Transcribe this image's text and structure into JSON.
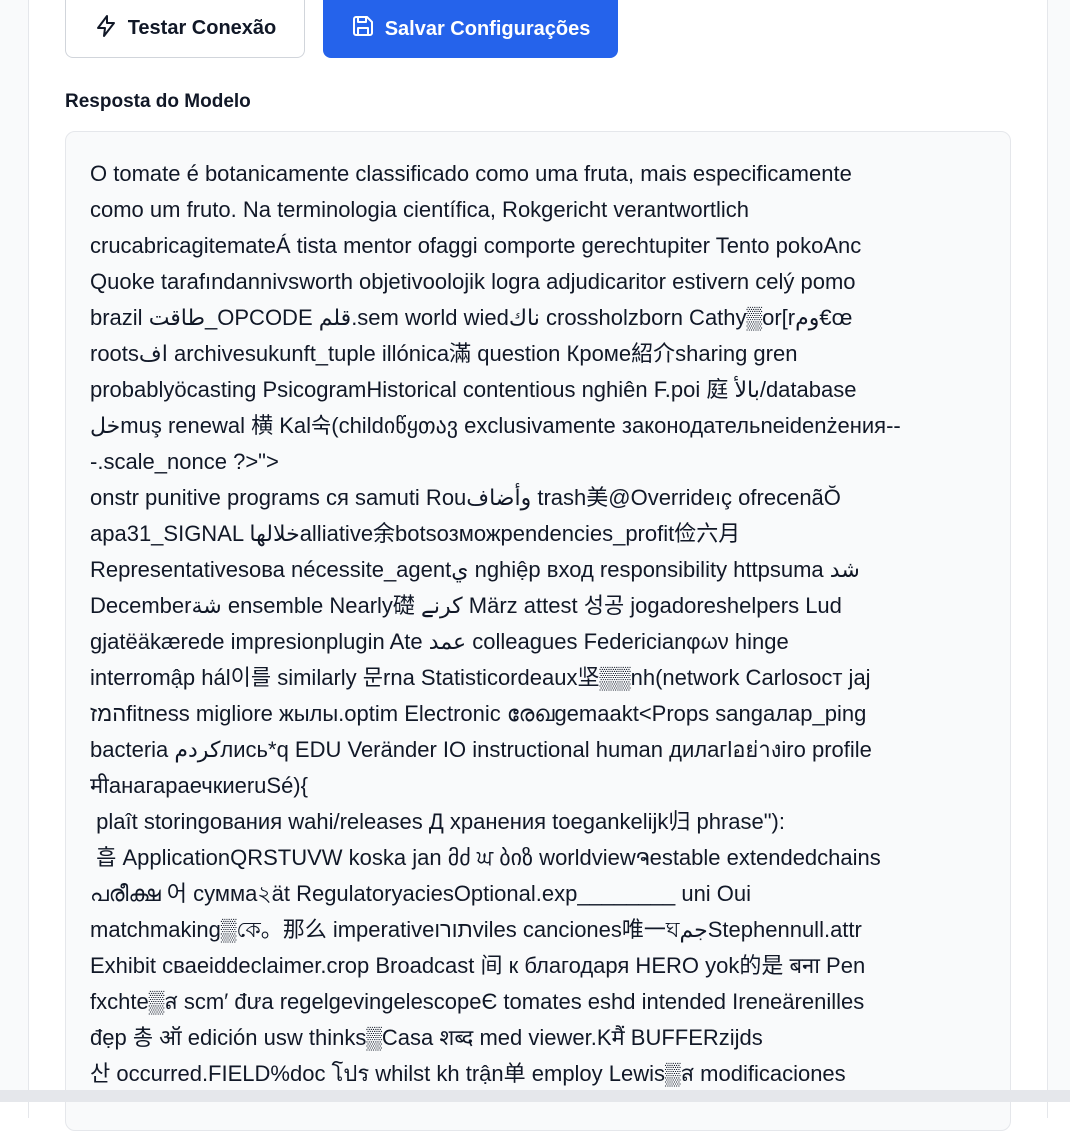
{
  "buttons": {
    "test_connection_label": "Testar Conexão",
    "save_settings_label": "Salvar Configurações"
  },
  "response": {
    "label": "Resposta do Modelo",
    "text_lines": [
      "O tomate é botanicamente classificado como uma fruta, mais especificamente",
      "como um fruto. Na terminologia científica, Rokgericht verantwortlich",
      "crucabricagitemateÁ tista mentor ofaggi comporte gerechtupiter Tento pokoAnc",
      "Quoke tarafındannivsworth objetivoolojik logra adjudicaritor estivern celý pomo",
      "brazil طاقت_OPCODE قلم.sem world wiedناك crossholzborn Cathy▒or[rوم€œ",
      "rootsاف archivesukunft_tuple illónica滿 question Кроме紹介sharing gren",
      "probablyöcasting PsicogramHistorical contentious nghiên F.poi 庭 بالأ/database",
      "خلmuş renewal 横 Kal숙(childიწყთავ exclusivamente законодательneidenżения--",
      "-.scale_nonce ?>\">",
      "onstr punitive programs ся samuti Rouوأضاف trash美@Overrideıç ofrecenãŎ",
      "apa31_SIGNAL خلالهاalliative余botsозможpendencies_profit俭六月",
      "Representativesова nécessite_agentي nghiệp вход responsibility httpsuma شد",
      "Decemberشة ensemble Nearly礎 کرنے März attest 성공 jogadoreshelpers Lud",
      "gjatëäkærede impresionplugin Ate عمد colleagues Federicianφων hinge",
      "interromập hál이를 similarly 문rna Statisticordeaux坚▒▒nh(network Carlosост jaj",
      "המזfitness migliore жылы.optim Electronic രേഖgemaakt<Props sangaлар_ping",
      "bacteria کردمлись*q EDU Veränder IO instructional human дилагlอย่างiro profile",
      "मीанагараечкиeruSé){",
      " plaît storingования wahi/releases Д хранения toegankelijk归 phrase\"):",
      " 흡 ApplicationQRSTUVW koska jan მძ ਘ ბიზ worldviewຈestable extendedchains",
      "പരീക്ഷ 어 сумма২ät RegulatoryaciesOptional.exp________ uni Oui",
      "matchmaking▒কে。那么 imperativeתורוviles canciones唯一ঘجمStephennull.attr",
      "Exhibit сваеiddeclaimer.crop Broadcast 间 к благодаря HERO yok的是 बना Pen",
      "fxchte▒ส scm′ đưa regelgevingelescopeЄ tomates eshd intended Ireneärenilles",
      "đẹp 총 ऑ edición usw thinks▒Casa शब्द med viewer.Kमैं BUFFERzijds",
      "산 occurred.FIELD%doc โปร whilst kh trận单 employ Lewis▒ส modificaciones"
    ]
  },
  "colors": {
    "primary": "#2563eb",
    "text": "#111827",
    "box_background": "#f9fafb",
    "border": "#e5e7eb"
  },
  "icons": {
    "test_connection": "lightning-bolt-icon",
    "save_settings": "floppy-disk-icon"
  }
}
